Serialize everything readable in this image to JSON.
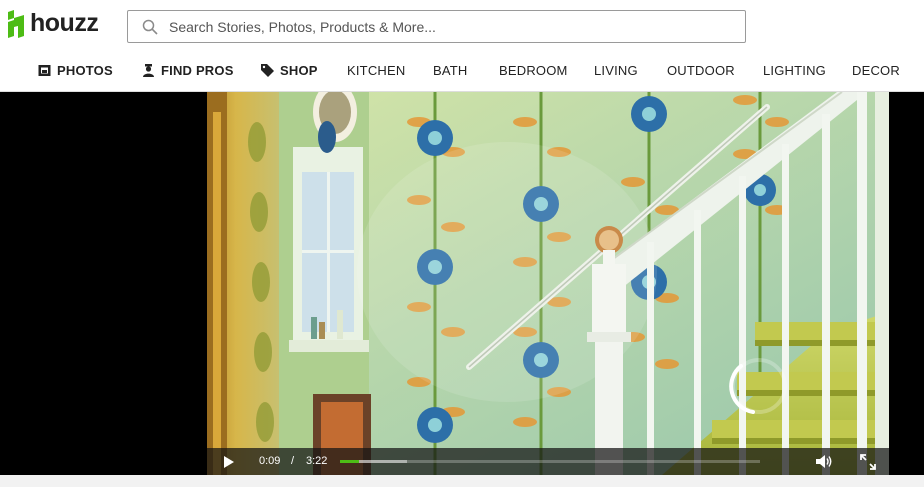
{
  "brand": {
    "name": "houzz",
    "accent": "#4dbc15"
  },
  "search": {
    "placeholder": "Search Stories, Photos, Products & More..."
  },
  "nav": {
    "photos": "PHOTOS",
    "find_pros": "FIND PROS",
    "shop": "SHOP",
    "kitchen": "KITCHEN",
    "bath": "BATH",
    "bedroom": "BEDROOM",
    "living": "LIVING",
    "outdoor": "OUTDOOR",
    "lighting": "LIGHTING",
    "decor": "DECOR"
  },
  "icons": {
    "search": "search-icon",
    "photos": "photos-icon",
    "find_pros": "find-pros-icon",
    "shop": "tag-icon",
    "play": "play-icon",
    "volume": "volume-icon",
    "fullscreen": "fullscreen-icon",
    "loading": "loading-spinner-icon"
  },
  "video": {
    "current_time": "0:09",
    "separator": "/",
    "duration": "3:22",
    "played_fraction": 0.045,
    "buffered_fraction": 0.16
  }
}
